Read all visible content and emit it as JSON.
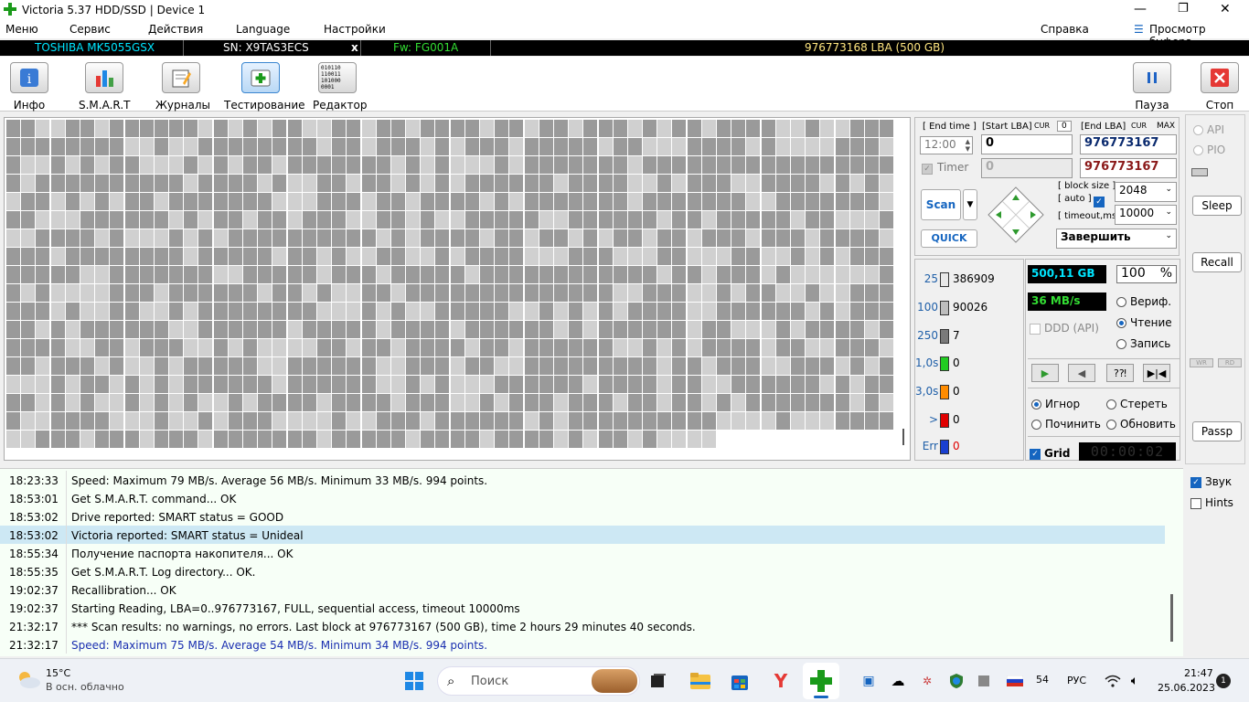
{
  "window": {
    "title": "Victoria 5.37 HDD/SSD | Device 1",
    "min": "—",
    "max": "❐",
    "close": "✕"
  },
  "menu": {
    "items": [
      "Меню",
      "Сервис",
      "Действия",
      "Language",
      "Настройки"
    ],
    "help": "Справка",
    "buffer": "Просмотр буфера"
  },
  "device": {
    "model": "TOSHIBA MK5055GSX",
    "serial": "SN: X9TAS3ECS",
    "x": "x",
    "firmware": "Fw: FG001A",
    "capacity": "976773168 LBA (500 GB)"
  },
  "toolbar": {
    "info": "Инфо",
    "smart": "S.M.A.R.T",
    "logs": "Журналы",
    "testing": "Тестирование",
    "editor": "Редактор",
    "pause": "Пауза",
    "stop": "Стоп",
    "editor_icon_text": "010110 110011 101000 0001"
  },
  "scan": {
    "end_time_label": "[ End time ]",
    "start_lba_label": "[Start LBA]",
    "cur_label": "CUR",
    "cur_value": "0",
    "end_lba_label": "[End LBA]",
    "cur2_label": "CUR",
    "max_label": "MAX",
    "end_time": "12:00",
    "start_lba": "0",
    "end_lba": "976773167",
    "timer_label": "Timer",
    "timer_value": "0",
    "end_lba2": "976773167",
    "scan_btn": "Scan",
    "quick_btn": "QUICK",
    "block_size_label": "[ block size ]",
    "auto_label": "[ auto ]",
    "timeout_label": "[ timeout,ms ]",
    "block_size": "2048",
    "timeout": "10000",
    "finish": "Завершить"
  },
  "stats": [
    {
      "n": "25",
      "v": "386909",
      "color": "#e8e8e8",
      "ncolor": "#1f5fa8"
    },
    {
      "n": "100",
      "v": "90026",
      "color": "#bdbdbd",
      "ncolor": "#1f5fa8"
    },
    {
      "n": "250",
      "v": "7",
      "color": "#7a7a7a",
      "ncolor": "#1f5fa8"
    },
    {
      "n": "1,0s",
      "v": "0",
      "color": "#22cc22",
      "ncolor": "#1f5fa8"
    },
    {
      "n": "3,0s",
      "v": "0",
      "color": "#ff8c00",
      "ncolor": "#1f5fa8"
    },
    {
      "n": ">",
      "v": "0",
      "color": "#e00000",
      "ncolor": "#1f5fa8"
    },
    {
      "n": "Err",
      "v": "0",
      "color": "#1a3fd0",
      "ncolor": "#1f5fa8"
    }
  ],
  "info": {
    "size": "500,11 GB",
    "percent": "100",
    "percent_sign": "%",
    "speed": "36 MB/s",
    "ddd": "DDD (API)",
    "verify": "Вериф.",
    "read": "Чтение",
    "write": "Запись",
    "ignore": "Игнор",
    "erase": "Стереть",
    "repair": "Починить",
    "refresh": "Обновить",
    "grid": "Grid",
    "clock": "00:00:02",
    "play_icons": [
      "▶",
      "◀",
      "?⁈",
      "▶|◀"
    ]
  },
  "right": {
    "api": "API",
    "pio": "PIO",
    "sleep": "Sleep",
    "recall": "Recall",
    "wr": "WR",
    "rd": "RD",
    "passp": "Passp",
    "sound": "Звук",
    "hints": "Hints"
  },
  "log": [
    {
      "t": "18:23:33",
      "m": "Speed: Maximum 79 MB/s. Average 56 MB/s. Minimum 33 MB/s. 994 points.",
      "style": "normal"
    },
    {
      "t": "18:53:01",
      "m": "Get S.M.A.R.T. command... OK",
      "style": "normal"
    },
    {
      "t": "18:53:02",
      "m": "Drive reported: SMART status = GOOD",
      "style": "normal"
    },
    {
      "t": "18:53:02",
      "m": "Victoria reported: SMART status = Unideal",
      "style": "selected"
    },
    {
      "t": "18:55:34",
      "m": "Получение паспорта накопителя... OK",
      "style": "normal"
    },
    {
      "t": "18:55:35",
      "m": "Get S.M.A.R.T. Log directory... OK.",
      "style": "normal"
    },
    {
      "t": "19:02:37",
      "m": "Recallibration... OK",
      "style": "normal"
    },
    {
      "t": "19:02:37",
      "m": "Starting Reading, LBA=0..976773167, FULL, sequential access, timeout 10000ms",
      "style": "normal"
    },
    {
      "t": "21:32:17",
      "m": "*** Scan results: no warnings, no errors. Last block at 976773167 (500 GB), time 2 hours 29 minutes 40 seconds.",
      "style": "normal"
    },
    {
      "t": "21:32:17",
      "m": "Speed: Maximum 75 MB/s. Average 54 MB/s. Minimum 34 MB/s. 994 points.",
      "style": "blue"
    }
  ],
  "taskbar": {
    "temp": "15°C",
    "weather": "В осн. облачно",
    "search": "Поиск",
    "lang": "РУС",
    "count": "54",
    "time": "21:47",
    "date": "25.06.2023",
    "notif": "1"
  },
  "colors": {
    "accent": "#1565c0",
    "green_text": "#33dd33",
    "cyan_text": "#00e5ff",
    "blue_log": "#1a2fb0",
    "selected_row": "#cde8f4"
  }
}
